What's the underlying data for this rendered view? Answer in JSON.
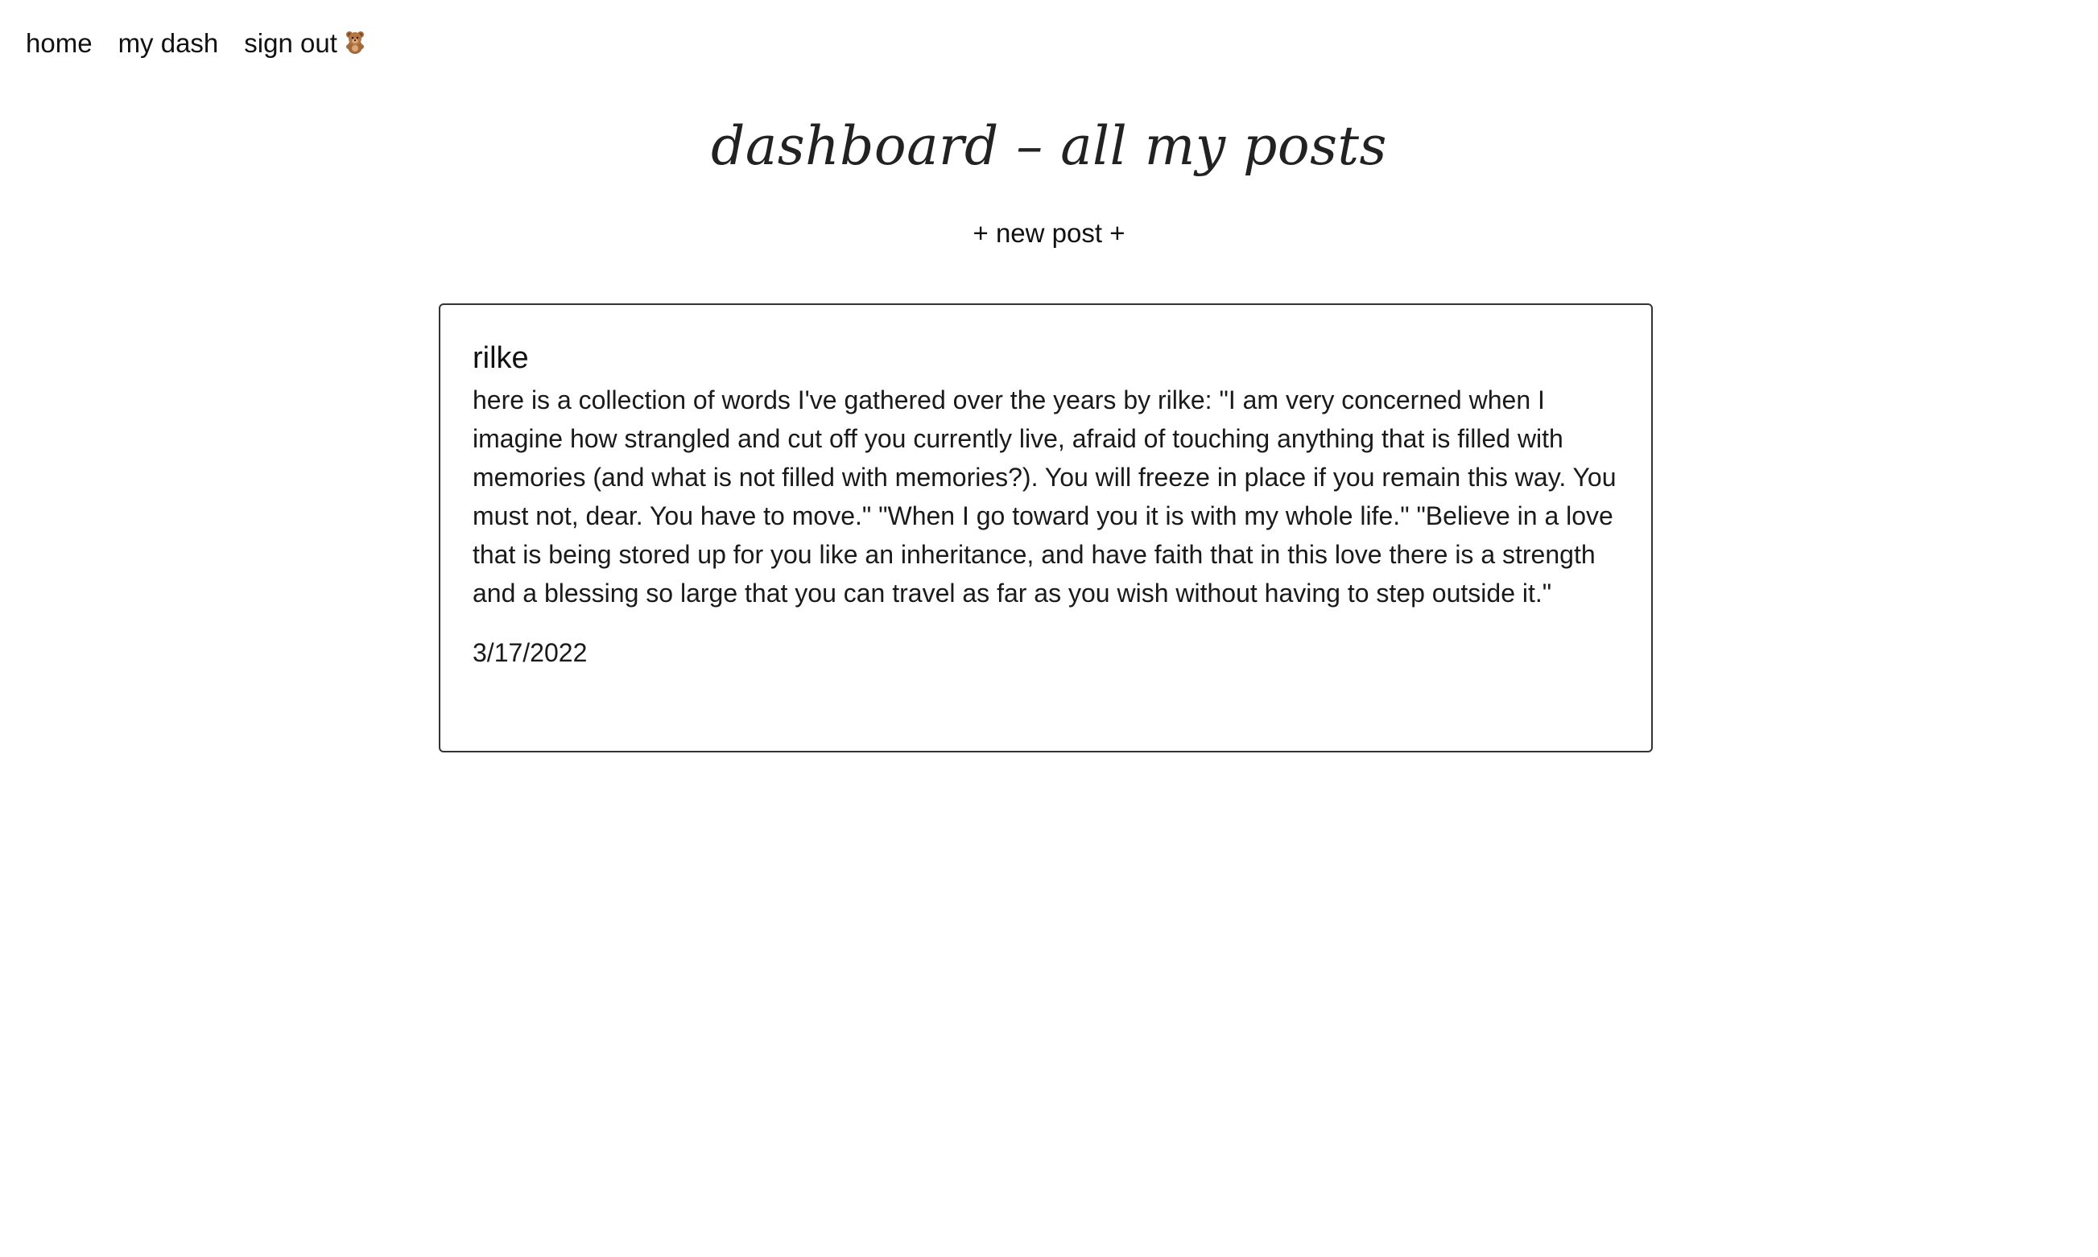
{
  "nav": {
    "home_label": "home",
    "dash_label": "my dash",
    "signout_label": "sign out",
    "signout_icon": "teddy-bear-icon"
  },
  "page": {
    "title": "dashboard – all my posts",
    "new_post_label": "+ new post +"
  },
  "posts": [
    {
      "title": "rilke",
      "body": "here is a collection of words I've gathered over the years by rilke: \"I am very concerned when I imagine how strangled and cut off you currently live, afraid of touching anything that is filled with memories (and what is not filled with memories?). You will freeze in place if you remain this way. You must not, dear. You have to move.\" \"When I go toward you it is with my whole life.\" \"Believe in a love that is being stored up for you like an inheritance, and have faith that in this love there is a strength and a blessing so large that you can travel as far as you wish without having to step outside it.\"",
      "date": "3/17/2022"
    }
  ],
  "colors": {
    "background": "#ffffff",
    "text": "#111111",
    "card_border": "#333333"
  }
}
